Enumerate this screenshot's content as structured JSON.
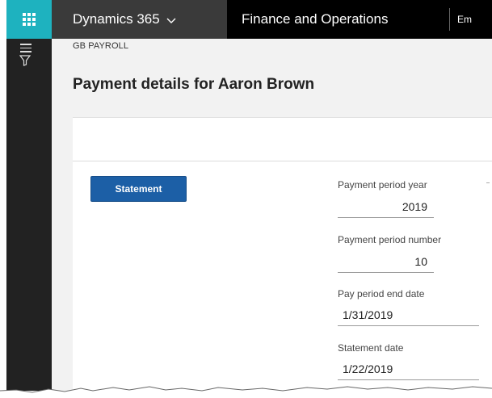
{
  "topbar": {
    "app_name": "Dynamics 365",
    "module_name": "Finance and Operations",
    "company_truncated": "Em"
  },
  "icons": {
    "waffle": "app-launcher-icon",
    "chevron": "chevron-down-icon",
    "menu": "hamburger-icon",
    "filter": "filter-icon"
  },
  "page": {
    "breadcrumb": "GB PAYROLL",
    "title": "Payment details for Aaron Brown"
  },
  "actions": {
    "statement_label": "Statement"
  },
  "fields": {
    "payment_period_year": {
      "label": "Payment period year",
      "value": "2019"
    },
    "payment_period_number": {
      "label": "Payment period number",
      "value": "10"
    },
    "pay_period_end_date": {
      "label": "Pay period end date",
      "value": "1/31/2019"
    },
    "statement_date": {
      "label": "Statement date",
      "value": "1/22/2019"
    }
  },
  "colors": {
    "waffle_bg": "#1eb2bf",
    "app_bg": "#3a3a3a",
    "nav_bg": "#000000",
    "primary_button": "#1c5fa6"
  }
}
